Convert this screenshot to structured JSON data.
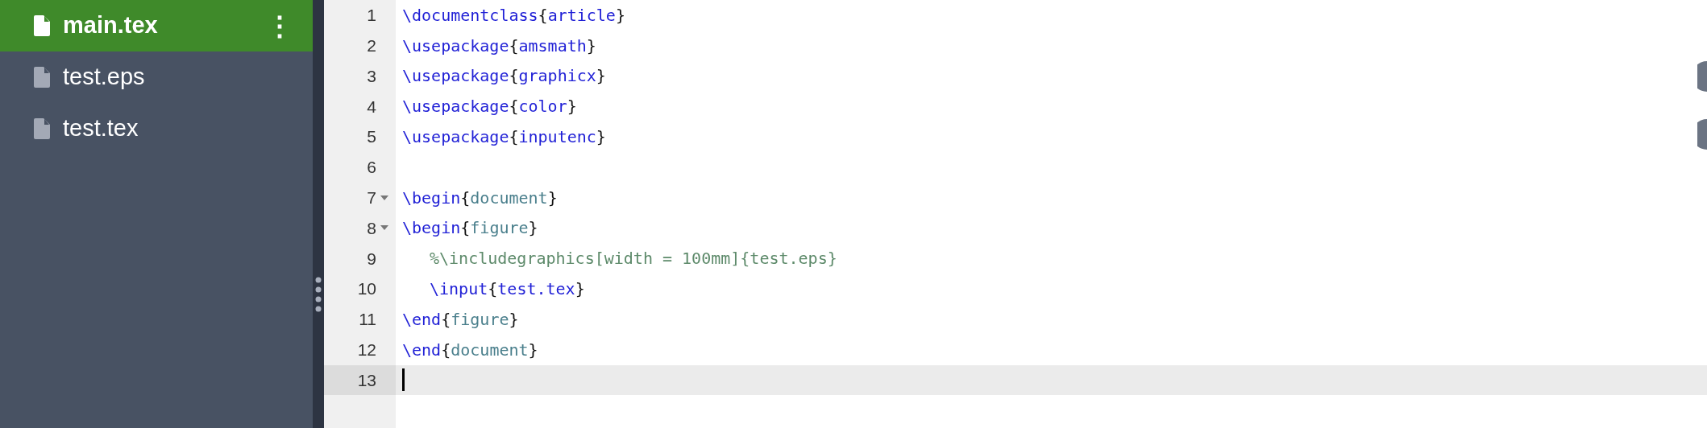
{
  "file_tree": [
    {
      "name": "main.tex",
      "selected": true,
      "menu": "⋮"
    },
    {
      "name": "test.eps",
      "selected": false
    },
    {
      "name": "test.tex",
      "selected": false
    }
  ],
  "editor": {
    "lines": [
      {
        "number": "1",
        "foldable": false,
        "active": false,
        "indent": false,
        "tokens": [
          {
            "kind": "command",
            "text": "\\documentclass"
          },
          {
            "kind": "brace",
            "text": "{"
          },
          {
            "kind": "arg",
            "text": "article"
          },
          {
            "kind": "brace",
            "text": "}"
          }
        ]
      },
      {
        "number": "2",
        "foldable": false,
        "active": false,
        "indent": false,
        "tokens": [
          {
            "kind": "command",
            "text": "\\usepackage"
          },
          {
            "kind": "brace",
            "text": "{"
          },
          {
            "kind": "arg",
            "text": "amsmath"
          },
          {
            "kind": "brace",
            "text": "}"
          }
        ]
      },
      {
        "number": "3",
        "foldable": false,
        "active": false,
        "indent": false,
        "tokens": [
          {
            "kind": "command",
            "text": "\\usepackage"
          },
          {
            "kind": "brace",
            "text": "{"
          },
          {
            "kind": "arg",
            "text": "graphicx"
          },
          {
            "kind": "brace",
            "text": "}"
          }
        ]
      },
      {
        "number": "4",
        "foldable": false,
        "active": false,
        "indent": false,
        "tokens": [
          {
            "kind": "command",
            "text": "\\usepackage"
          },
          {
            "kind": "brace",
            "text": "{"
          },
          {
            "kind": "arg",
            "text": "color"
          },
          {
            "kind": "brace",
            "text": "}"
          }
        ]
      },
      {
        "number": "5",
        "foldable": false,
        "active": false,
        "indent": false,
        "tokens": [
          {
            "kind": "command",
            "text": "\\usepackage"
          },
          {
            "kind": "brace",
            "text": "{"
          },
          {
            "kind": "arg",
            "text": "inputenc"
          },
          {
            "kind": "brace",
            "text": "}"
          }
        ]
      },
      {
        "number": "6",
        "foldable": false,
        "active": false
      },
      {
        "number": "7",
        "foldable": true,
        "active": false,
        "indent": false,
        "tokens": [
          {
            "kind": "command",
            "text": "\\begin"
          },
          {
            "kind": "brace",
            "text": "{"
          },
          {
            "kind": "env",
            "text": "document"
          },
          {
            "kind": "brace",
            "text": "}"
          }
        ]
      },
      {
        "number": "8",
        "foldable": true,
        "active": false,
        "indent": false,
        "tokens": [
          {
            "kind": "command",
            "text": "\\begin"
          },
          {
            "kind": "brace",
            "text": "{"
          },
          {
            "kind": "env",
            "text": "figure"
          },
          {
            "kind": "brace",
            "text": "}"
          }
        ]
      },
      {
        "number": "9",
        "foldable": false,
        "active": false,
        "indent": true,
        "tokens": [
          {
            "kind": "comment",
            "text": "%\\includegraphics[width = 100mm]{test.eps}"
          }
        ]
      },
      {
        "number": "10",
        "foldable": false,
        "active": false,
        "indent": true,
        "tokens": [
          {
            "kind": "command",
            "text": "\\input"
          },
          {
            "kind": "brace",
            "text": "{"
          },
          {
            "kind": "arg",
            "text": "test.tex"
          },
          {
            "kind": "brace",
            "text": "}"
          }
        ]
      },
      {
        "number": "11",
        "foldable": false,
        "active": false,
        "indent": false,
        "tokens": [
          {
            "kind": "command",
            "text": "\\end"
          },
          {
            "kind": "brace",
            "text": "{"
          },
          {
            "kind": "env",
            "text": "figure"
          },
          {
            "kind": "brace",
            "text": "}"
          }
        ]
      },
      {
        "number": "12",
        "foldable": false,
        "active": false,
        "indent": false,
        "tokens": [
          {
            "kind": "command",
            "text": "\\end"
          },
          {
            "kind": "brace",
            "text": "{"
          },
          {
            "kind": "env",
            "text": "document"
          },
          {
            "kind": "brace",
            "text": "}"
          }
        ]
      },
      {
        "number": "13",
        "foldable": false,
        "active": true
      }
    ]
  }
}
